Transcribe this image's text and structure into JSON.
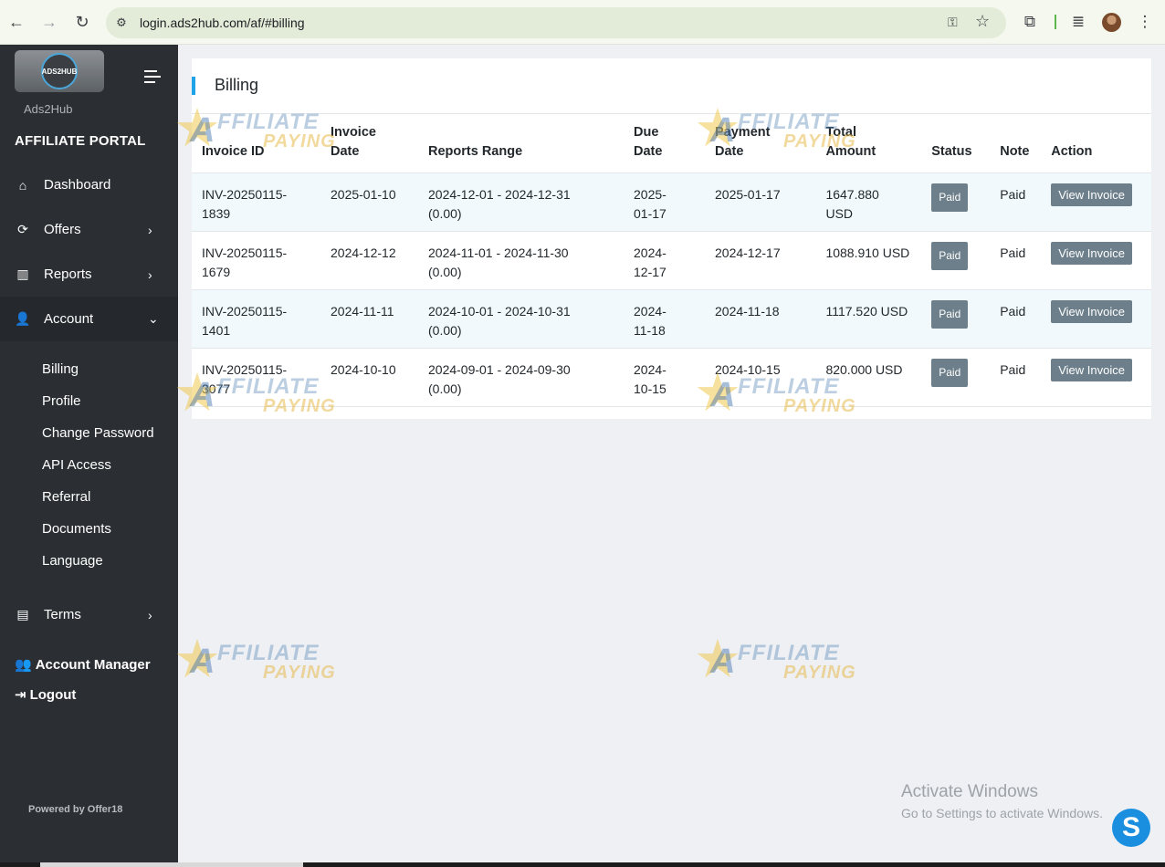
{
  "browser": {
    "url": "login.ads2hub.com/af/#billing"
  },
  "sidebar": {
    "logo_text": "ADS2HUB",
    "brand": "Ads2Hub",
    "portal_title": "AFFILIATE PORTAL",
    "items": [
      {
        "label": "Dashboard",
        "icon": "home-icon",
        "chevron": ""
      },
      {
        "label": "Offers",
        "icon": "refresh-icon",
        "chevron": "›"
      },
      {
        "label": "Reports",
        "icon": "bar-chart-icon",
        "chevron": "›"
      },
      {
        "label": "Account",
        "icon": "user-cog-icon",
        "chevron": "⌄"
      }
    ],
    "account_sub": [
      "Billing",
      "Profile",
      "Change Password",
      "API Access",
      "Referral",
      "Documents",
      "Language"
    ],
    "terms": "Terms",
    "account_manager": "Account Manager",
    "logout": "Logout",
    "powered_by": "Powered by Offer18"
  },
  "billing": {
    "title": "Billing",
    "columns": [
      "Invoice ID",
      "Invoice Date",
      "Reports Range",
      "Due Date",
      "Payment Date",
      "Total Amount",
      "Status",
      "Note",
      "Action"
    ],
    "rows": [
      {
        "invoice_id": "INV-20250115-1839",
        "invoice_date": "2025-01-10",
        "range": "2024-12-01 - 2024-12-31 (0.00)",
        "due_date": "2025-01-17",
        "payment_date": "2025-01-17",
        "amount": "1647.880 USD",
        "status": "Paid",
        "note": "Paid",
        "action": "View Invoice"
      },
      {
        "invoice_id": "INV-20250115-1679",
        "invoice_date": "2024-12-12",
        "range": "2024-11-01 - 2024-11-30 (0.00)",
        "due_date": "2024-12-17",
        "payment_date": "2024-12-17",
        "amount": "1088.910 USD",
        "status": "Paid",
        "note": "Paid",
        "action": "View Invoice"
      },
      {
        "invoice_id": "INV-20250115-1401",
        "invoice_date": "2024-11-11",
        "range": "2024-10-01 - 2024-10-31 (0.00)",
        "due_date": "2024-11-18",
        "payment_date": "2024-11-18",
        "amount": "1117.520 USD",
        "status": "Paid",
        "note": "Paid",
        "action": "View Invoice"
      },
      {
        "invoice_id": "INV-20250115-3077",
        "invoice_date": "2024-10-10",
        "range": "2024-09-01 - 2024-09-30 (0.00)",
        "due_date": "2024-10-15",
        "payment_date": "2024-10-15",
        "amount": "820.000 USD",
        "status": "Paid",
        "note": "Paid",
        "action": "View Invoice"
      }
    ]
  },
  "watermark": {
    "line1": "FFILIATE",
    "line2": "PAYING",
    "letter": "A"
  },
  "os_notice": {
    "title": "Activate Windows",
    "subtitle": "Go to Settings to activate Windows."
  },
  "skype_letter": "S",
  "colors": {
    "sidebar_bg": "#2b2f33",
    "accent": "#1ea3e8",
    "badge": "#6c7f8a",
    "row_stripe": "#f2f9fd"
  }
}
